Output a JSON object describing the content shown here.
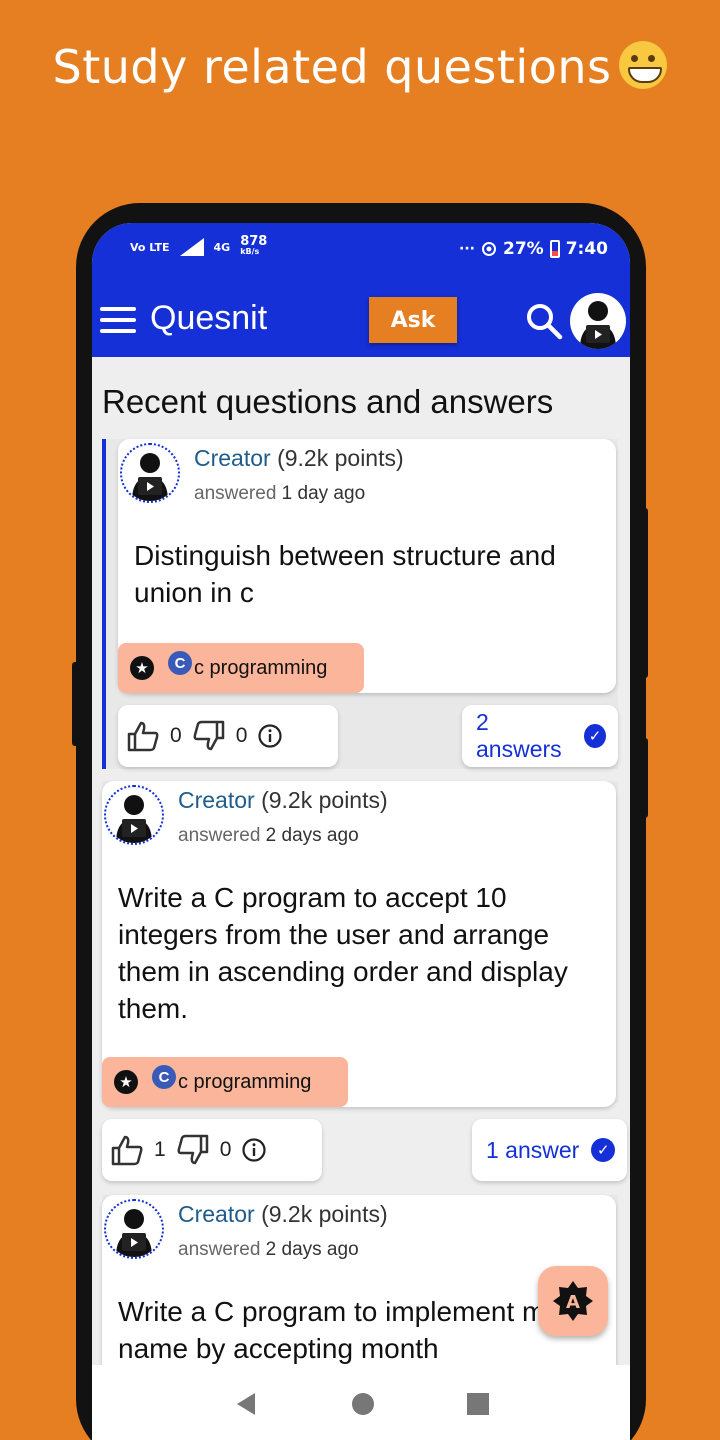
{
  "promo": {
    "title": "Study related questions"
  },
  "status": {
    "carrier": "Vo LTE",
    "network": "4G",
    "speed": "878",
    "speed_unit": "kB/s",
    "dots": "···",
    "battery": "27%",
    "time": "7:40"
  },
  "appbar": {
    "brand": "Quesnit",
    "ask_label": "Ask"
  },
  "page": {
    "title": "Recent questions and answers"
  },
  "posts": [
    {
      "author": "Creator",
      "points": "(9.2k points)",
      "action": "answered",
      "when": "1 day ago",
      "question": "Distinguish between structure and union in c",
      "tag": "c programming",
      "upvotes": "0",
      "downvotes": "0",
      "answers": "2 answers"
    },
    {
      "author": "Creator",
      "points": "(9.2k points)",
      "action": "answered",
      "when": "2 days ago",
      "question": "Write a C program to accept 10 integers from the user and arrange them in ascending order and display them.",
      "tag": "c programming",
      "upvotes": "1",
      "downvotes": "0",
      "answers": "1 answer"
    },
    {
      "author": "Creator",
      "points": "(9.2k points)",
      "action": "answered",
      "when": "2 days ago",
      "question": "Write a C program to implement month name by accepting month"
    }
  ],
  "colors": {
    "background": "#E67E22",
    "primary": "#1430D6",
    "tag": "#FBB59A"
  }
}
